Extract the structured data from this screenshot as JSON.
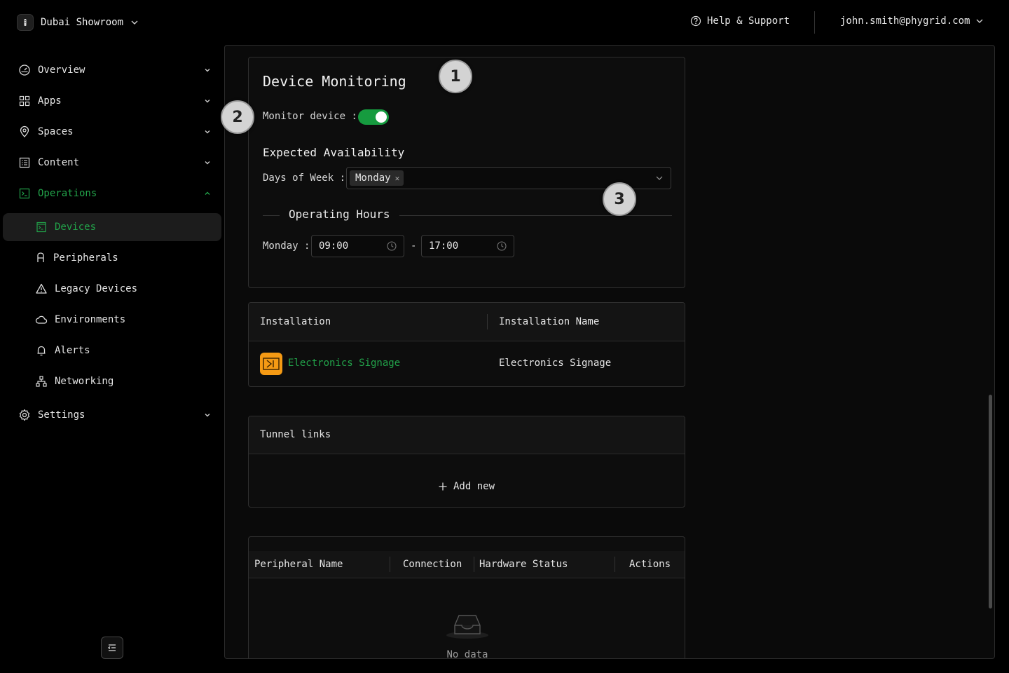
{
  "header": {
    "workspace": "Dubai Showroom",
    "help": "Help & Support",
    "user": "john.smith@phygrid.com"
  },
  "sidebar": {
    "items": [
      {
        "label": "Overview",
        "icon": "dashboard-icon"
      },
      {
        "label": "Apps",
        "icon": "grid-icon"
      },
      {
        "label": "Spaces",
        "icon": "location-pin-icon"
      },
      {
        "label": "Content",
        "icon": "content-list-icon"
      },
      {
        "label": "Operations",
        "icon": "terminal-icon"
      },
      {
        "label": "Settings",
        "icon": "gear-icon"
      }
    ],
    "sub_items": [
      {
        "label": "Devices",
        "icon": "device-icon"
      },
      {
        "label": "Peripherals",
        "icon": "peripheral-icon"
      },
      {
        "label": "Legacy Devices",
        "icon": "warning-triangle-icon"
      },
      {
        "label": "Environments",
        "icon": "cloud-icon"
      },
      {
        "label": "Alerts",
        "icon": "bell-icon"
      },
      {
        "label": "Networking",
        "icon": "network-icon"
      }
    ]
  },
  "monitoring": {
    "title": "Device Monitoring",
    "monitor_label": "Monitor device",
    "monitor_on": true,
    "availability_title": "Expected Availability",
    "days_label": "Days of Week",
    "days": [
      "Monday"
    ],
    "operating_hours_title": "Operating Hours",
    "hours": [
      {
        "day": "Monday",
        "start": "09:00",
        "end": "17:00"
      }
    ],
    "range_sep": "-"
  },
  "installation": {
    "columns": [
      "Installation",
      "Installation Name"
    ],
    "rows": [
      {
        "installation": "Electronics Signage",
        "name": "Electronics Signage"
      }
    ]
  },
  "tunnel": {
    "title": "Tunnel links",
    "add_label": "Add new"
  },
  "peripherals": {
    "columns": [
      "Peripheral Name",
      "Connection",
      "Hardware Status",
      "Actions"
    ],
    "empty_text": "No data"
  },
  "annotations": [
    "1",
    "2",
    "3"
  ],
  "colors": {
    "accent": "#22a34a",
    "toggle": "#169b3f",
    "installation_icon": "#f59a14"
  }
}
